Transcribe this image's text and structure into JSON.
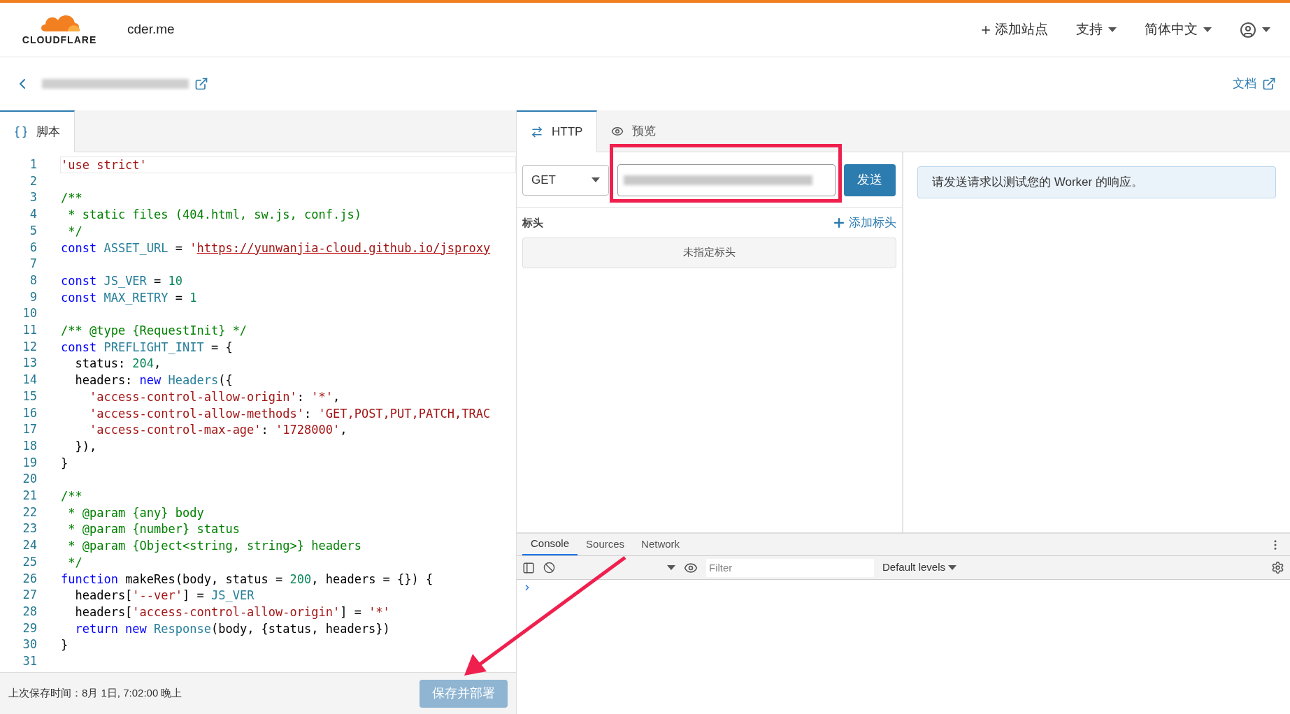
{
  "header": {
    "logo_text": "CLOUDFLARE",
    "site": "cder.me",
    "nav": [
      {
        "kind": "add",
        "label": "添加站点"
      },
      {
        "kind": "menu",
        "label": "支持"
      },
      {
        "kind": "menu",
        "label": "简体中文"
      },
      {
        "kind": "user"
      }
    ]
  },
  "breadcrumb": {
    "docs_link": "文档"
  },
  "editor": {
    "tabs": [
      {
        "label": "脚本",
        "selected": true
      }
    ],
    "lines": [
      {
        "number": "1",
        "current": true,
        "tokens": [
          {
            "kind": "str",
            "text": "'use strict'"
          }
        ]
      },
      {
        "number": "2",
        "current": false
      },
      {
        "number": "3",
        "current": false,
        "tokens": [
          {
            "kind": "comment",
            "text": "/**"
          }
        ]
      },
      {
        "number": "4",
        "current": false,
        "tokens": [
          {
            "kind": "comment",
            "text": " * static files (404.html, sw.js, conf.js)"
          }
        ]
      },
      {
        "number": "5",
        "current": false,
        "tokens": [
          {
            "kind": "comment",
            "text": " */"
          }
        ]
      },
      {
        "number": "6",
        "current": false,
        "tokens": [
          {
            "kind": "kw",
            "text": "const "
          },
          {
            "kind": "var",
            "text": "ASSET_URL"
          },
          {
            "kind": "plain",
            "text": " = "
          },
          {
            "kind": "str",
            "text": "'"
          },
          {
            "kind": "link",
            "text": "https://yunwanjia-cloud.github.io/jsproxy"
          }
        ]
      },
      {
        "number": "7",
        "current": false
      },
      {
        "number": "8",
        "current": false,
        "tokens": [
          {
            "kind": "kw",
            "text": "const "
          },
          {
            "kind": "var",
            "text": "JS_VER"
          },
          {
            "kind": "plain",
            "text": " = "
          },
          {
            "kind": "num",
            "text": "10"
          }
        ]
      },
      {
        "number": "9",
        "current": false,
        "tokens": [
          {
            "kind": "kw",
            "text": "const "
          },
          {
            "kind": "var",
            "text": "MAX_RETRY"
          },
          {
            "kind": "plain",
            "text": " = "
          },
          {
            "kind": "num",
            "text": "1"
          }
        ]
      },
      {
        "number": "10",
        "current": false
      },
      {
        "number": "11",
        "current": false,
        "tokens": [
          {
            "kind": "comment",
            "text": "/** @type {RequestInit} */"
          }
        ]
      },
      {
        "number": "12",
        "current": false,
        "tokens": [
          {
            "kind": "kw",
            "text": "const "
          },
          {
            "kind": "var",
            "text": "PREFLIGHT_INIT"
          },
          {
            "kind": "plain",
            "text": " = {"
          }
        ]
      },
      {
        "number": "13",
        "current": false,
        "tokens": [
          {
            "kind": "plain",
            "text": "  status: "
          },
          {
            "kind": "num",
            "text": "204"
          },
          {
            "kind": "plain",
            "text": ","
          }
        ]
      },
      {
        "number": "14",
        "current": false,
        "tokens": [
          {
            "kind": "plain",
            "text": "  headers: "
          },
          {
            "kind": "kw",
            "text": "new "
          },
          {
            "kind": "var",
            "text": "Headers"
          },
          {
            "kind": "plain",
            "text": "({"
          }
        ]
      },
      {
        "number": "15",
        "current": false,
        "tokens": [
          {
            "kind": "str",
            "text": "    'access-control-allow-origin'"
          },
          {
            "kind": "plain",
            "text": ": "
          },
          {
            "kind": "str",
            "text": "'*'"
          },
          {
            "kind": "plain",
            "text": ","
          }
        ]
      },
      {
        "number": "16",
        "current": false,
        "tokens": [
          {
            "kind": "str",
            "text": "    'access-control-allow-methods'"
          },
          {
            "kind": "plain",
            "text": ": "
          },
          {
            "kind": "str",
            "text": "'GET,POST,PUT,PATCH,TRAC"
          }
        ]
      },
      {
        "number": "17",
        "current": false,
        "tokens": [
          {
            "kind": "str",
            "text": "    'access-control-max-age'"
          },
          {
            "kind": "plain",
            "text": ": "
          },
          {
            "kind": "str",
            "text": "'1728000'"
          },
          {
            "kind": "plain",
            "text": ","
          }
        ]
      },
      {
        "number": "18",
        "current": false,
        "tokens": [
          {
            "kind": "plain",
            "text": "  }),"
          }
        ]
      },
      {
        "number": "19",
        "current": false,
        "tokens": [
          {
            "kind": "plain",
            "text": "}"
          }
        ]
      },
      {
        "number": "20",
        "current": false
      },
      {
        "number": "21",
        "current": false,
        "tokens": [
          {
            "kind": "comment",
            "text": "/**"
          }
        ]
      },
      {
        "number": "22",
        "current": false,
        "tokens": [
          {
            "kind": "comment",
            "text": " * @param {any} body"
          }
        ]
      },
      {
        "number": "23",
        "current": false,
        "tokens": [
          {
            "kind": "comment",
            "text": " * @param {number} status"
          }
        ]
      },
      {
        "number": "24",
        "current": false,
        "tokens": [
          {
            "kind": "comment",
            "text": " * @param {Object<string, string>} headers"
          }
        ]
      },
      {
        "number": "25",
        "current": false,
        "tokens": [
          {
            "kind": "comment",
            "text": " */"
          }
        ]
      },
      {
        "number": "26",
        "current": false,
        "tokens": [
          {
            "kind": "kw",
            "text": "function "
          },
          {
            "kind": "plain",
            "text": "makeRes(body, status = "
          },
          {
            "kind": "num",
            "text": "200"
          },
          {
            "kind": "plain",
            "text": ", headers = {}) {"
          }
        ]
      },
      {
        "number": "27",
        "current": false,
        "tokens": [
          {
            "kind": "plain",
            "text": "  headers["
          },
          {
            "kind": "str",
            "text": "'--ver'"
          },
          {
            "kind": "plain",
            "text": "] = "
          },
          {
            "kind": "var",
            "text": "JS_VER"
          }
        ]
      },
      {
        "number": "28",
        "current": false,
        "tokens": [
          {
            "kind": "plain",
            "text": "  headers["
          },
          {
            "kind": "str",
            "text": "'access-control-allow-origin'"
          },
          {
            "kind": "plain",
            "text": "] = "
          },
          {
            "kind": "str",
            "text": "'*'"
          }
        ]
      },
      {
        "number": "29",
        "current": false,
        "tokens": [
          {
            "kind": "kw",
            "text": "  return new "
          },
          {
            "kind": "var",
            "text": "Response"
          },
          {
            "kind": "plain",
            "text": "(body, {status, headers})"
          }
        ]
      },
      {
        "number": "30",
        "current": false,
        "tokens": [
          {
            "kind": "plain",
            "text": "}"
          }
        ]
      },
      {
        "number": "31",
        "current": false
      }
    ],
    "last_saved": "上次保存时间：8月 1日, 7:02:00 晚上",
    "deploy_button": {
      "label": "保存并部署",
      "disabled": true
    }
  },
  "tester": {
    "tabs": [
      {
        "kind": "http",
        "label": "HTTP",
        "selected": true
      },
      {
        "kind": "preview",
        "label": "预览",
        "selected": false
      }
    ],
    "method": "GET",
    "send_button": "发送",
    "headers_label": "标头",
    "add_header": "添加标头",
    "no_headers": "未指定标头",
    "response_message": "请发送请求以测试您的 Worker 的响应。"
  },
  "devtools": {
    "tabs": [
      {
        "label": "Console",
        "selected": true
      },
      {
        "label": "Sources",
        "selected": false
      },
      {
        "label": "Network",
        "selected": false
      }
    ],
    "filter_placeholder": "Filter",
    "levels": "Default levels"
  }
}
